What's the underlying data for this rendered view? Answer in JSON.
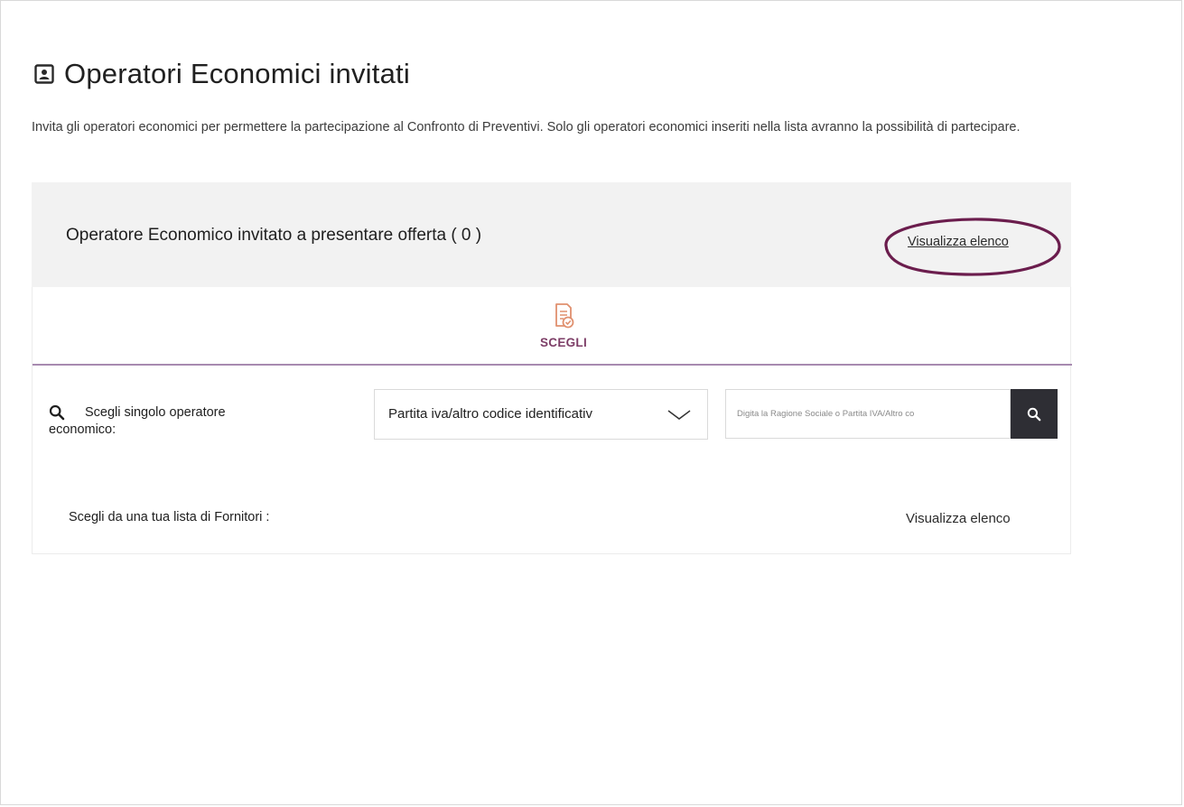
{
  "header": {
    "title": "Operatori Economici invitati",
    "title_icon": "contact-card-icon",
    "description": "Invita gli operatori economici per permettere la partecipazione al Confronto di Preventivi. Solo gli operatori economici inseriti nella lista avranno la possibilità  di partecipare."
  },
  "invited": {
    "title": "Operatore Economico invitato a presentare offerta ( 0 )",
    "count": 0,
    "link_label": "Visualizza elenco",
    "highlight_color": "#6b1d4d"
  },
  "choose": {
    "tab_label": "SCEGLI",
    "tab_icon": "document-check-icon",
    "accent_color": "#7d3e67",
    "single_search": {
      "label_line1": "Scegli singolo operatore",
      "label_line2": "economico:",
      "icon": "search-icon",
      "select_value": "Partita iva/altro codice identificativ",
      "input_placeholder": "Digita la Ragione Sociale o Partita IVA/Altro co",
      "button_icon": "search-icon"
    },
    "supplier_list": {
      "label": "Scegli da una tua lista di Fornitori :",
      "link_label": "Visualizza elenco"
    }
  }
}
